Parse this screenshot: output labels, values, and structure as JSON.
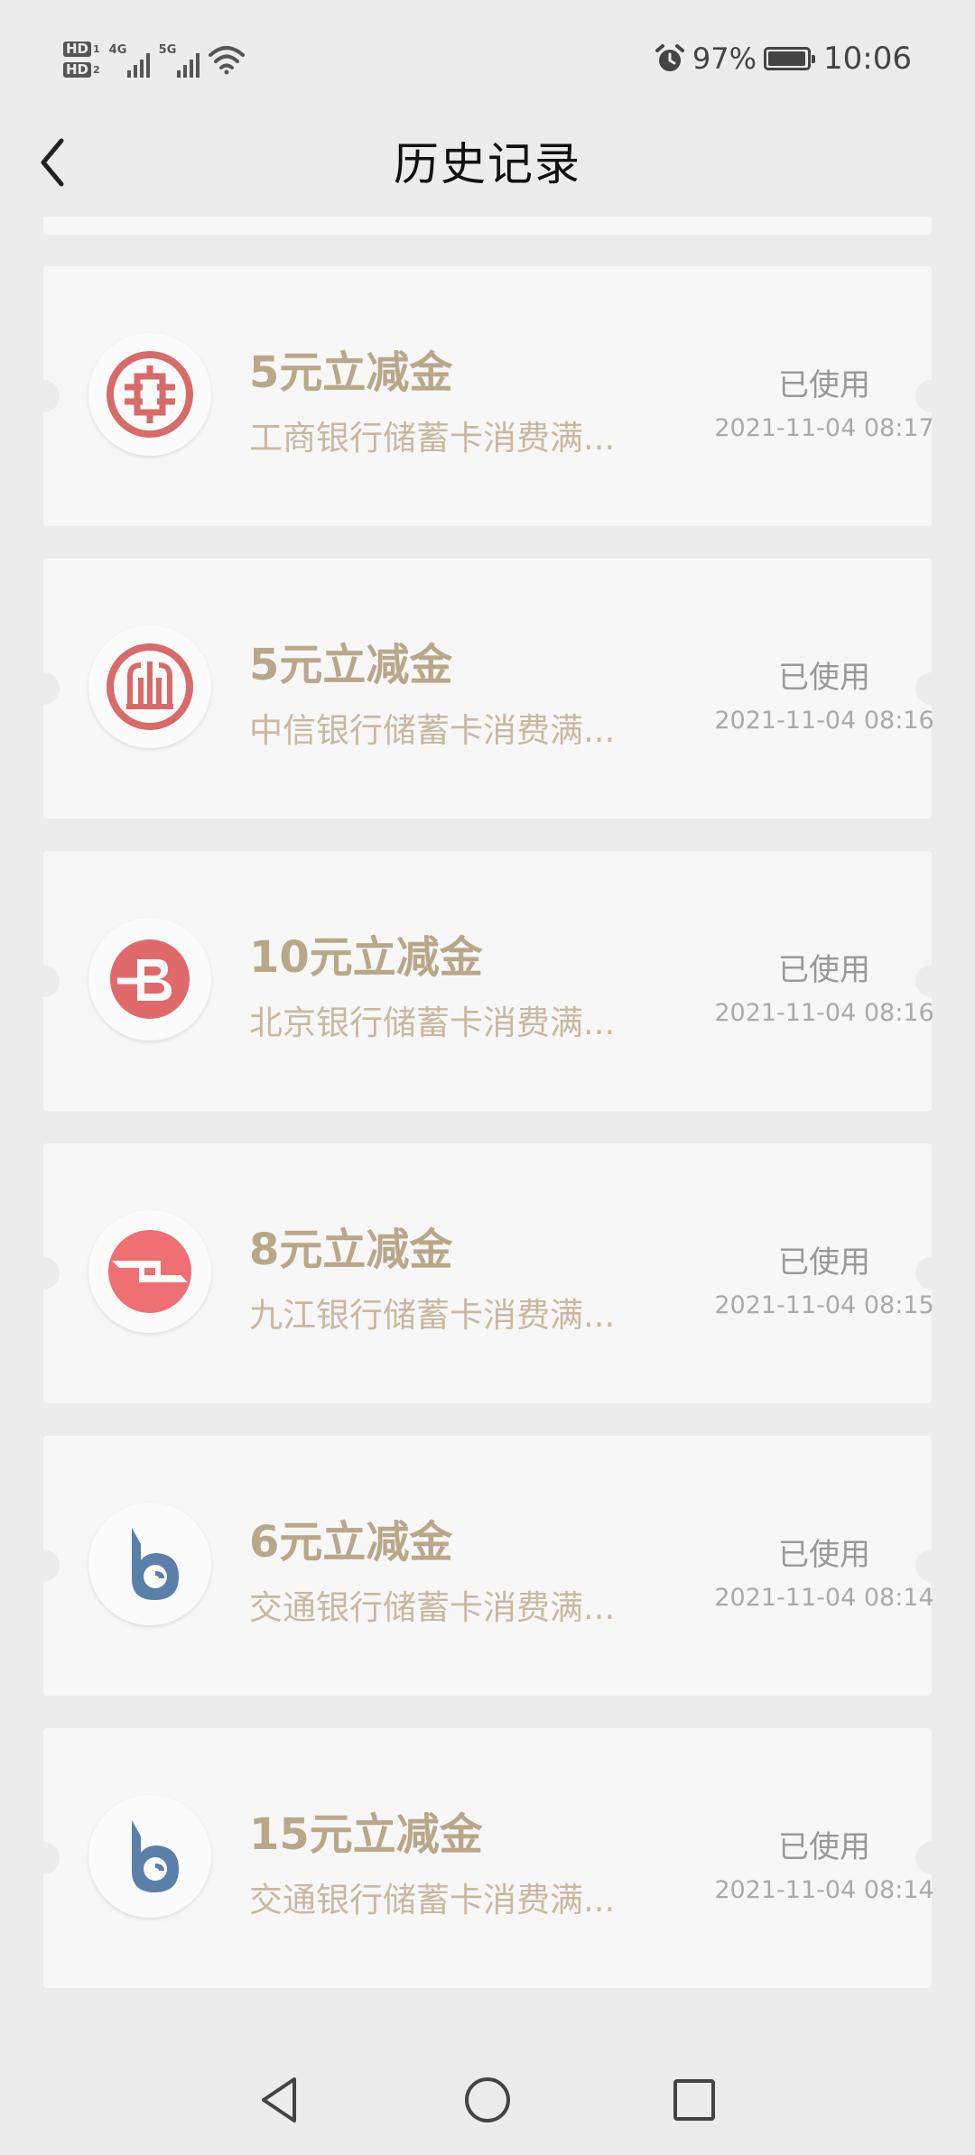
{
  "status_bar": {
    "sim1": "HD",
    "sim1_sub": "1",
    "sim2": "HD",
    "sim2_sub": "2",
    "net1": "4G",
    "net2": "5G",
    "battery_percent": "97%",
    "battery_level": 0.97,
    "time": "10:06",
    "icons": [
      "signal-icon",
      "wifi-icon",
      "alarm-icon",
      "battery-icon"
    ]
  },
  "header": {
    "title": "历史记录",
    "back_icon": "chevron-left-icon"
  },
  "coupons": [
    {
      "amount": "5元立减金",
      "desc": "工商银行储蓄卡消费满...",
      "status": "已使用",
      "time": "2021-11-04 08:17",
      "logo": "icbc-logo-icon",
      "logo_color": "#d86a6a"
    },
    {
      "amount": "5元立减金",
      "desc": "中信银行储蓄卡消费满...",
      "status": "已使用",
      "time": "2021-11-04 08:16",
      "logo": "citic-logo-icon",
      "logo_color": "#d86a6a"
    },
    {
      "amount": "10元立减金",
      "desc": "北京银行储蓄卡消费满...",
      "status": "已使用",
      "time": "2021-11-04 08:16",
      "logo": "bob-logo-icon",
      "logo_color": "#e06a6a"
    },
    {
      "amount": "8元立减金",
      "desc": "九江银行储蓄卡消费满...",
      "status": "已使用",
      "time": "2021-11-04 08:15",
      "logo": "jiujiang-logo-icon",
      "logo_color": "#ef6f72"
    },
    {
      "amount": "6元立减金",
      "desc": "交通银行储蓄卡消费满...",
      "status": "已使用",
      "time": "2021-11-04 08:14",
      "logo": "bocom-logo-icon",
      "logo_color": "#5a7fa8"
    },
    {
      "amount": "15元立减金",
      "desc": "交通银行储蓄卡消费满...",
      "status": "已使用",
      "time": "2021-11-04 08:14",
      "logo": "bocom-logo-icon",
      "logo_color": "#5a7fa8"
    }
  ],
  "colors": {
    "background": "#ececec",
    "card": "#f7f7f7",
    "amount_text": "#b9a789",
    "desc_text": "#c9b8a0",
    "status_text": "#999999"
  },
  "nav_bar": {
    "buttons": [
      "back-triangle-icon",
      "home-circle-icon",
      "recents-square-icon"
    ]
  }
}
